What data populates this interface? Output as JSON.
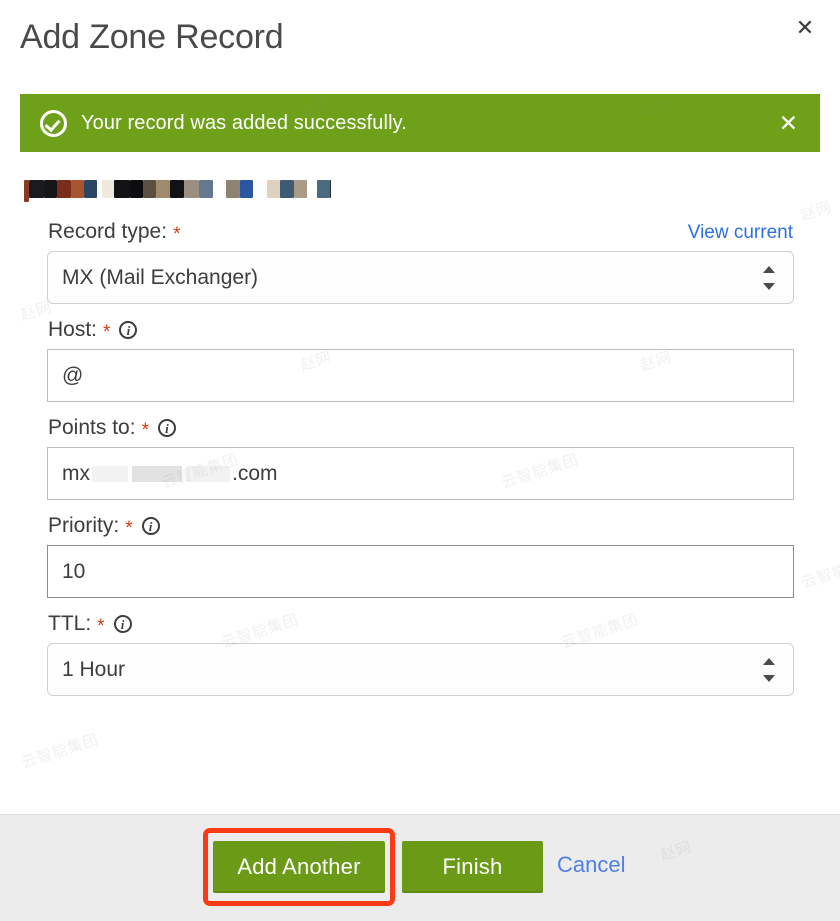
{
  "dialog": {
    "title": "Add Zone Record",
    "close_icon": "close-icon",
    "close_label": "✕"
  },
  "alert": {
    "icon": "check-circle-icon",
    "message": "Your record was added successfully.",
    "close_label": "✕",
    "background_color": "#6fa01a",
    "text_color": "#ffffff"
  },
  "domain_heading": {
    "redacted": true,
    "note": ""
  },
  "form": {
    "view_current_link": "View current",
    "required_marker": "*",
    "info_glyph": "i",
    "fields": [
      {
        "name": "record-type",
        "label": "Record type:",
        "required": true,
        "has_info": false,
        "control": "select",
        "value": "MX (Mail Exchanger)"
      },
      {
        "name": "host",
        "label": "Host:",
        "required": true,
        "has_info": true,
        "control": "input",
        "value": "@"
      },
      {
        "name": "points-to",
        "label": "Points to:",
        "required": true,
        "has_info": true,
        "control": "input-masked",
        "value_prefix": "mx",
        "value_suffix": ".com"
      },
      {
        "name": "priority",
        "label": "Priority:",
        "required": true,
        "has_info": true,
        "control": "input",
        "value": "10"
      },
      {
        "name": "ttl",
        "label": "TTL:",
        "required": true,
        "has_info": true,
        "control": "select",
        "value": "1 Hour"
      }
    ]
  },
  "footer": {
    "add_another_label": "Add Another",
    "finish_label": "Finish",
    "cancel_label": "Cancel",
    "button_color": "#6b9a17",
    "highlight_color": "#f83a16",
    "link_color": "#4f7fe8"
  },
  "watermarks": {
    "text_a": "云智能集团",
    "text_b": "赵网"
  }
}
